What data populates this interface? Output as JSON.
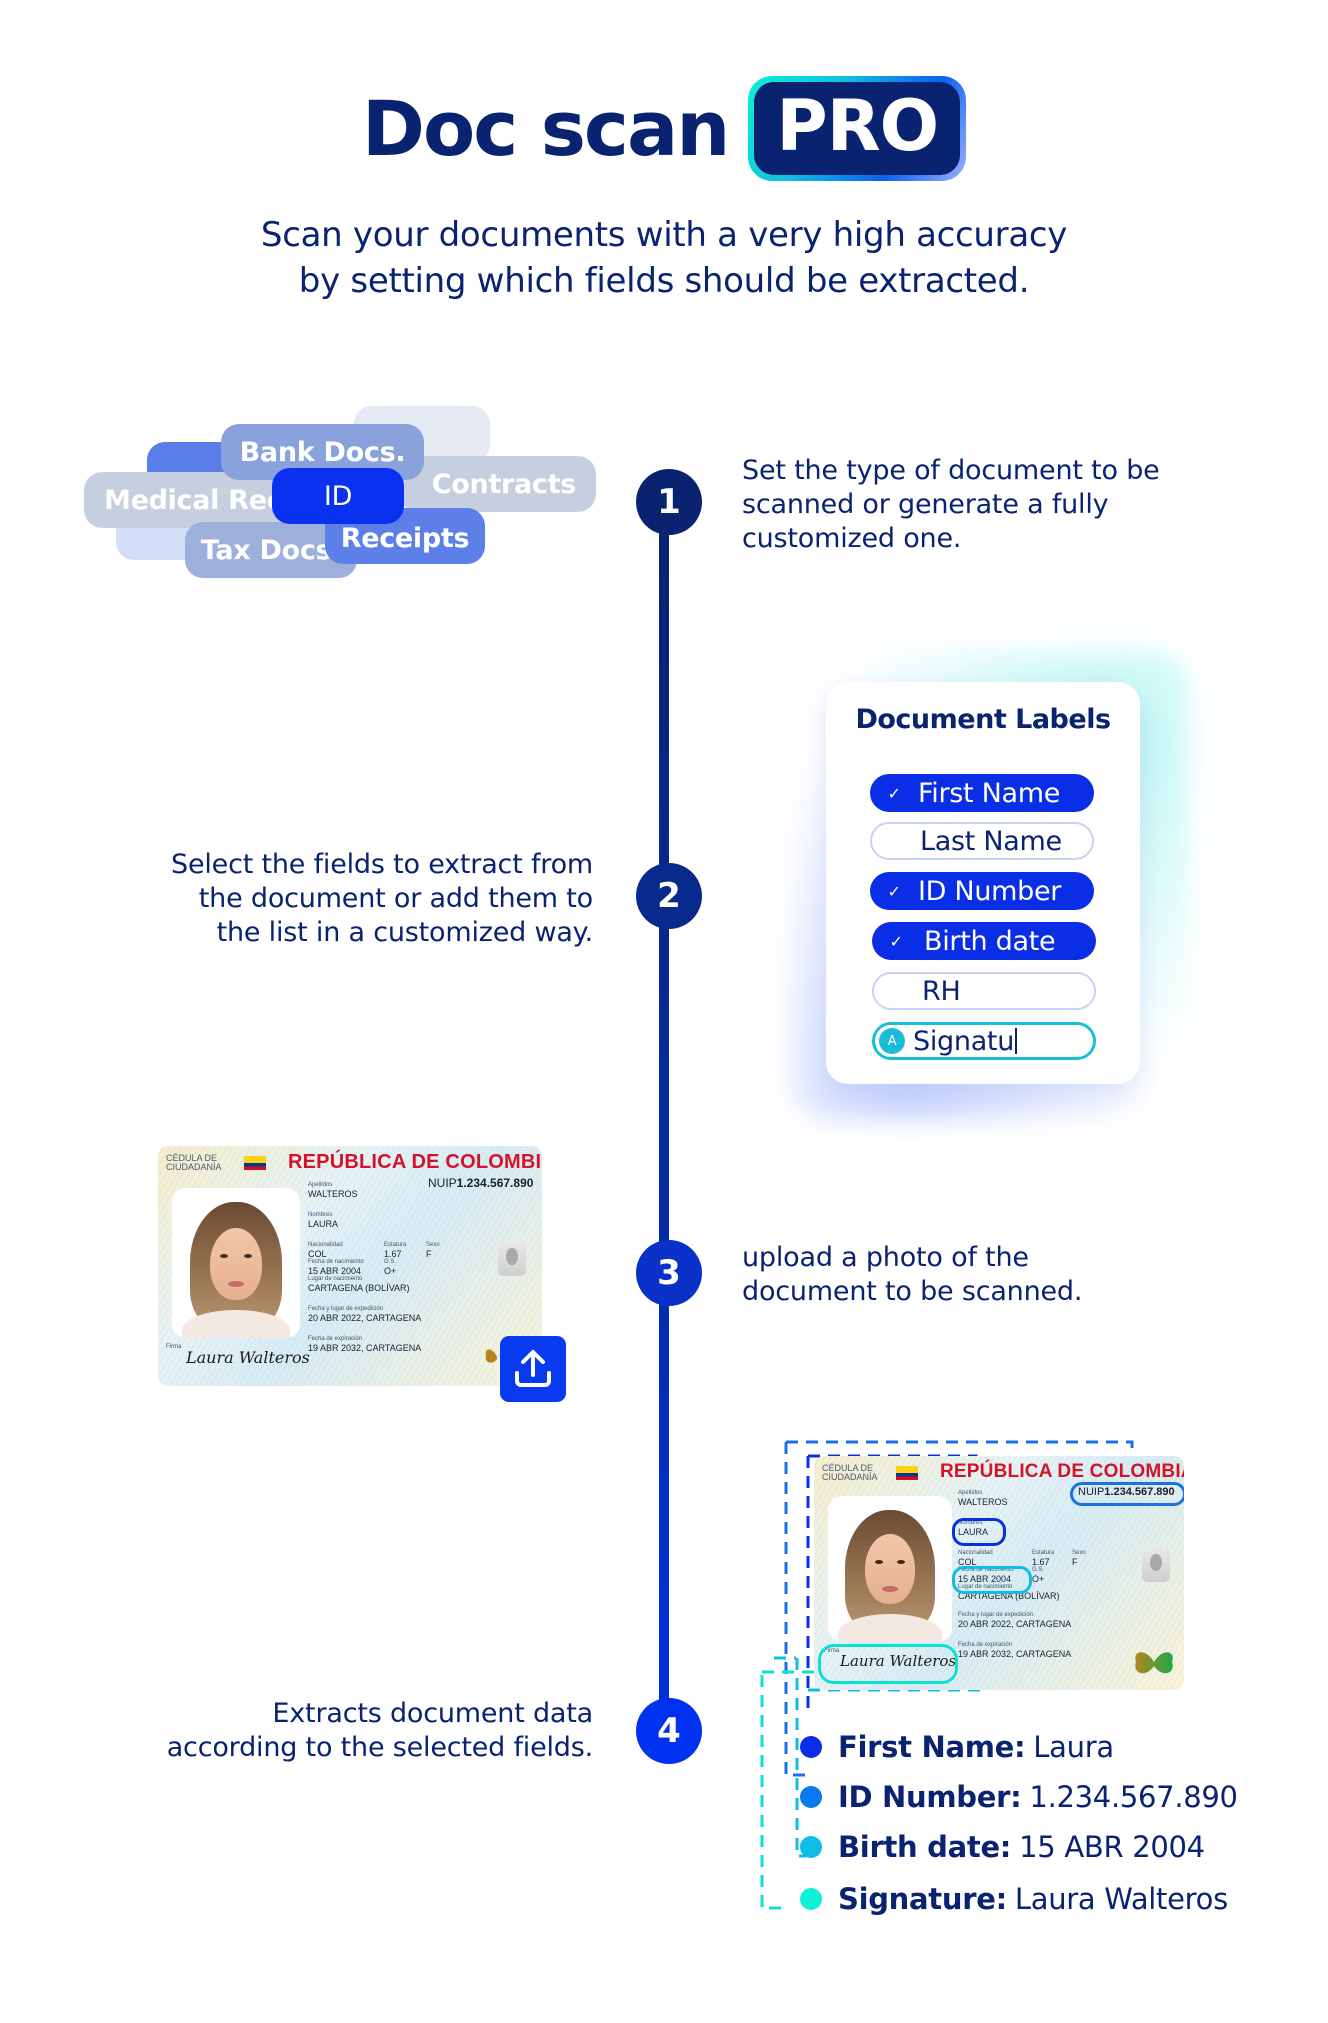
{
  "header": {
    "title": "Doc scan",
    "badge": "PRO",
    "subtitle_line1": "Scan your documents with a very high accuracy",
    "subtitle_line2": "by setting which fields should be extracted."
  },
  "colors": {
    "navy": "#0a2370",
    "primary_blue": "#0a2ee6",
    "cyan": "#19bfd8",
    "teal": "#10f0d0",
    "id_red": "#d4132a"
  },
  "steps": [
    {
      "number": "1",
      "text_lines": [
        "Set the type of document to be",
        "scanned or generate a fully",
        "customized one."
      ]
    },
    {
      "number": "2",
      "text_lines": [
        "Select the fields to extract from",
        "the document or add them to",
        "the list in a customized way."
      ]
    },
    {
      "number": "3",
      "text_lines": [
        "upload a photo of the",
        "document to be scanned."
      ]
    },
    {
      "number": "4",
      "text_lines": [
        "Extracts document data",
        "according to the selected fields."
      ]
    }
  ],
  "document_types": [
    {
      "label": "",
      "role": "background"
    },
    {
      "label": "",
      "role": "background"
    },
    {
      "label": "",
      "role": "background"
    },
    {
      "label": "Bank Docs.",
      "role": "chip"
    },
    {
      "label": "Medical Rec.",
      "role": "chip"
    },
    {
      "label": "Contracts",
      "role": "chip"
    },
    {
      "label": "Tax Docs.",
      "role": "chip"
    },
    {
      "label": "Receipts",
      "role": "chip"
    },
    {
      "label": "ID",
      "role": "selected"
    }
  ],
  "labels_card": {
    "title": "Document Labels",
    "items": [
      {
        "label": "First Name",
        "checked": true
      },
      {
        "label": "Last Name",
        "checked": false
      },
      {
        "label": "ID Number",
        "checked": true
      },
      {
        "label": "Birth date",
        "checked": true
      },
      {
        "label": "RH",
        "checked": false
      },
      {
        "label": "Signatu",
        "checked": false,
        "typing": true,
        "avatar": "A"
      }
    ],
    "check_glyph": "✓"
  },
  "id_card": {
    "doc_type_line1": "CÉDULA DE",
    "doc_type_line2": "CIUDADANÍA",
    "country": "REPÚBLICA DE COLOMBIA",
    "nuip_label": "NUIP",
    "nuip_value": "1.234.567.890",
    "fields": {
      "apellidos_label": "Apellidos",
      "apellidos": "WALTEROS",
      "nombres_label": "Nombres",
      "nombres": "LAURA",
      "nacionalidad_label": "Nacionalidad",
      "nacionalidad": "COL",
      "estatura_label": "Estatura",
      "estatura": "1.67",
      "sexo_label": "Sexo",
      "sexo": "F",
      "fecha_nac_label": "Fecha de nacimiento",
      "fecha_nac": "15 ABR 2004",
      "gs_label": "G.S.",
      "gs": "O+",
      "lugar_nac_label": "Lugar de nacimiento",
      "lugar_nac": "CARTAGENA (BOLÍVAR)",
      "expedicion_label": "Fecha y lugar de expedición",
      "expedicion": "20 ABR 2022, CARTAGENA",
      "expiracion_label": "Fecha de expiración",
      "expiracion": "19 ABR 2032, CARTAGENA",
      "firma_label": "Firma",
      "firma": "Laura Walteros"
    }
  },
  "upload": {
    "icon": "upload-icon"
  },
  "results": [
    {
      "key": "First Name:",
      "value": "Laura",
      "color": "#0a2ee6"
    },
    {
      "key": "ID Number:",
      "value": "1.234.567.890",
      "color": "#0a78ee"
    },
    {
      "key": "Birth date:",
      "value": "15 ABR 2004",
      "color": "#10bde6"
    },
    {
      "key": "Signature:",
      "value": "Laura Walteros",
      "color": "#10f0d8"
    }
  ]
}
